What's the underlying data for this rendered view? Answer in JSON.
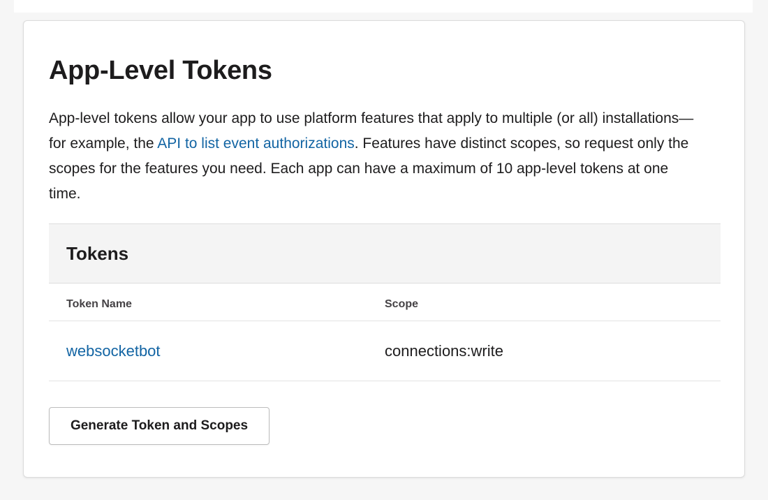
{
  "section": {
    "title": "App-Level Tokens",
    "description_part1": "App-level tokens allow your app to use platform features that apply to multiple (or all) installations—for example, the ",
    "description_link": "API to list event authorizations",
    "description_part2": ". Features have distinct scopes, so request only the scopes for the features you need. Each app can have a maximum of 10 app-level tokens at one time."
  },
  "tokens_panel": {
    "title": "Tokens",
    "columns": {
      "name": "Token Name",
      "scope": "Scope"
    },
    "rows": [
      {
        "name": "websocketbot",
        "scope": "connections:write"
      }
    ]
  },
  "actions": {
    "generate_label": "Generate Token and Scopes"
  },
  "colors": {
    "link": "#1264a3",
    "text": "#1d1c1d",
    "panel_header_bg": "#f4f4f4",
    "page_bg": "#f6f6f6"
  }
}
